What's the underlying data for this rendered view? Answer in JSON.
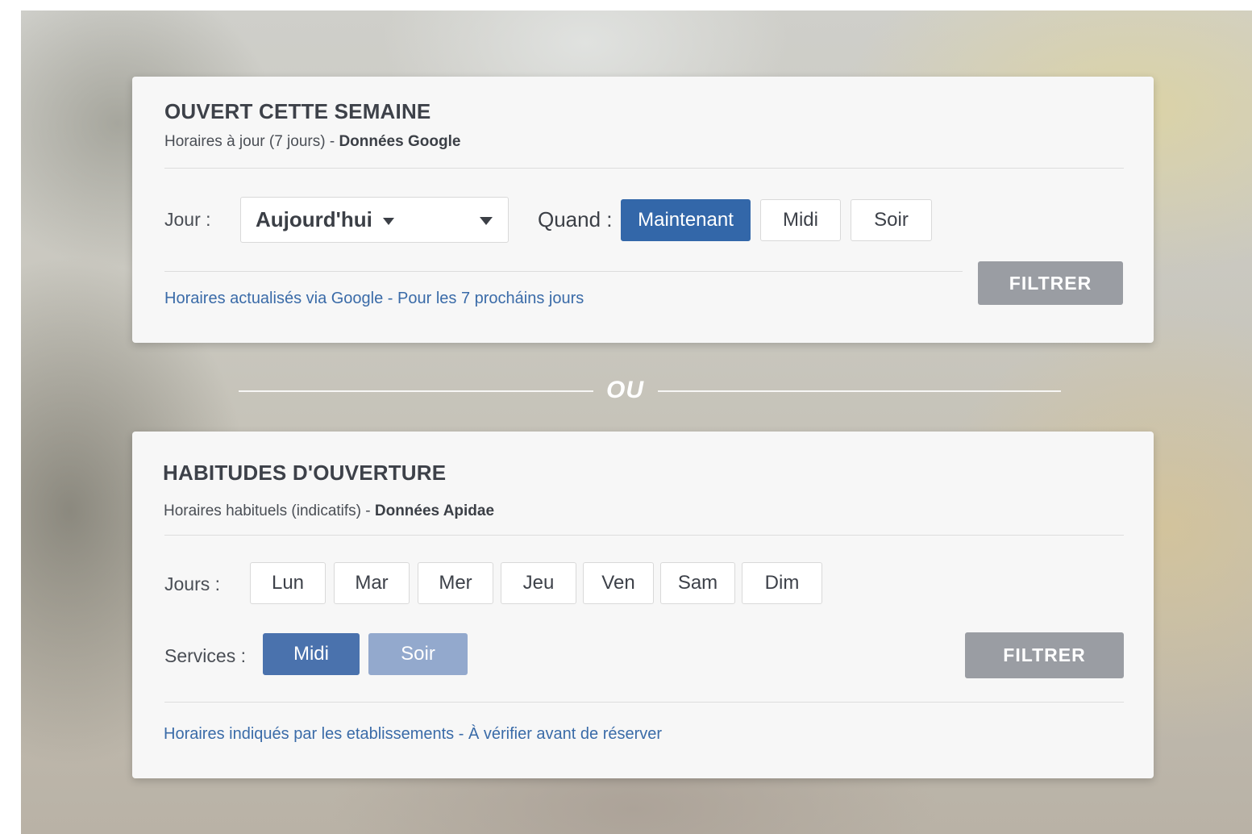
{
  "colors": {
    "primary": "#3367a9",
    "filter_button": "#9a9da3",
    "note_text": "#3a6ba8",
    "card_bg": "#f7f7f7"
  },
  "week_card": {
    "title": "OUVERT CETTE SEMAINE",
    "subtitle_prefix": "Horaires à jour (7 jours) - ",
    "subtitle_source": "Données Google",
    "day_label": "Jour :",
    "day_value": "Aujourd'hui",
    "day_icon": "chevron-down-icon",
    "when_label": "Quand :",
    "when_options": [
      "Maintenant",
      "Midi",
      "Soir"
    ],
    "when_selected": "Maintenant",
    "filter_label": "FILTRER",
    "note": "Horaires actualisés via Google - Pour les 7 procháins jours"
  },
  "separator": {
    "label": "OU"
  },
  "habits_card": {
    "title": "HABITUDES D'OUVERTURE",
    "subtitle_prefix": "Horaires habituels (indicatifs) - ",
    "subtitle_source": "Données Apidae",
    "days_label": "Jours :",
    "days": [
      "Lun",
      "Mar",
      "Mer",
      "Jeu",
      "Ven",
      "Sam",
      "Dim"
    ],
    "services_label": "Services :",
    "services": [
      "Midi",
      "Soir"
    ],
    "service_selected": "Midi",
    "filter_label": "FILTRER",
    "note": "Horaires indiqués par les etablissements - À vérifier avant de réserver"
  }
}
